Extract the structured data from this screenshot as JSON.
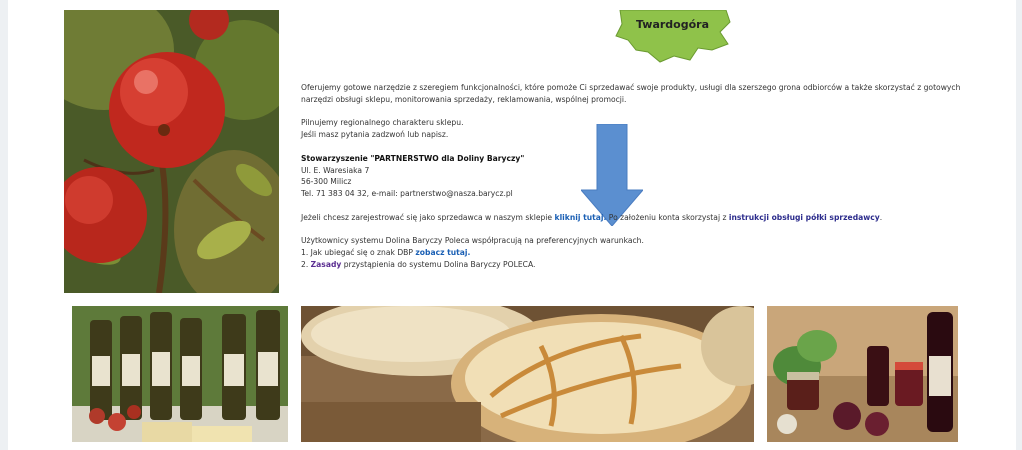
{
  "map": {
    "label": "Twardogóra"
  },
  "content": {
    "intro": "Oferujemy gotowe narzędzie z szeregiem funkcjonalności, które pomoże Ci sprzedawać swoje produkty, usługi dla szerszego grona odbiorców a także skorzystać z gotowych narzędzi obsługi sklepu, monitorowania sprzedaży, reklamowania, wspólnej promocji.",
    "regional_line1": "Pilnujemy regionalnego charakteru sklepu.",
    "regional_line2": "Jeśli masz pytania zadzwoń lub napisz.",
    "org_name": "Stowarzyszenie \"PARTNERSTWO dla Doliny Baryczy\"",
    "address_street": "Ul. E. Waresiaka 7",
    "address_city": "56-300 Milicz",
    "contact": "Tel. 71 383 04 32, e-mail: partnerstwo@nasza.barycz.pl",
    "register_text_before": "Jeżeli chcesz zarejestrować się jako sprzedawca w naszym sklepie ",
    "register_link": "kliknij tutaj.",
    "register_text_middle": " Po założeniu konta skorzystaj z ",
    "instructions_link": "instrukcji obsługi półki sprzedawcy",
    "register_text_end": ".",
    "users_line": "Użytkownicy systemu Dolina Baryczy Poleca współpracują na preferencyjnych warunkach.",
    "item1_text": "1. Jak ubiegać się o znak DBP ",
    "item1_link": "zobacz tutaj.",
    "item2_prefix": "2. ",
    "item2_link": "Zasady",
    "item2_text": " przystąpienia do systemu Dolina Baryczy POLECA."
  },
  "colors": {
    "link": "#1a5fb4",
    "arrow": "#5b8fd0",
    "map": "#8fc24a"
  }
}
